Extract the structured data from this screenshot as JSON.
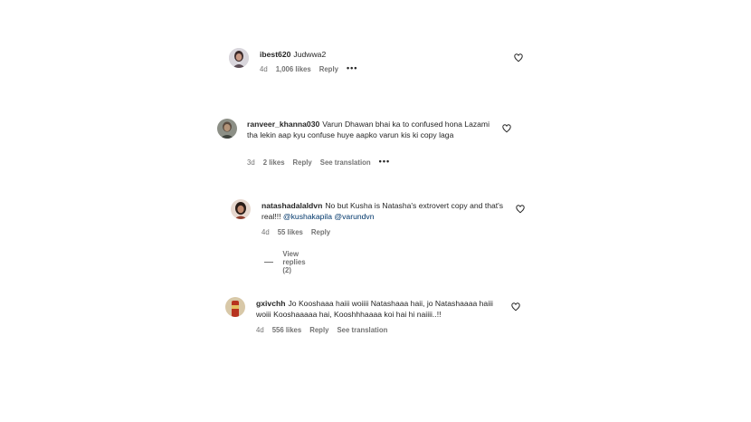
{
  "comments": [
    {
      "username": "ibest620",
      "text": "Judwwa2",
      "age": "4d",
      "likes": "1,006 likes",
      "reply": "Reply",
      "more": "•••"
    },
    {
      "username": "ranveer_khanna030",
      "text": "Varun Dhawan bhai ka to confused hona Lazami tha lekin aap kyu confuse huye aapko varun kis ki copy laga",
      "age": "3d",
      "likes": "2 likes",
      "reply": "Reply",
      "translation": "See translation",
      "more": "•••"
    },
    {
      "username": "natashadalaldvn",
      "text": "No but Kusha is Natasha's extrovert copy and that's real!!! ",
      "mention1": "@kushakapila",
      "mention2": "@varundvn",
      "age": "4d",
      "likes": "55 likes",
      "reply": "Reply",
      "view_replies": "View replies (2)"
    },
    {
      "username": "gxivchh",
      "text": "Jo Kooshaaa haiii woiiii Natashaaa haii, jo Natashaaaa haiii woiii Kooshaaaaa hai, Kooshhhaaaa koi hai hi naiiii..!!",
      "age": "4d",
      "likes": "556 likes",
      "reply": "Reply",
      "translation": "See translation"
    }
  ],
  "icons": {
    "heart": "heart-outline-icon",
    "more": "more-options-icon"
  },
  "colors": {
    "text": "#262626",
    "secondary": "#737373",
    "mention": "#00376b"
  }
}
